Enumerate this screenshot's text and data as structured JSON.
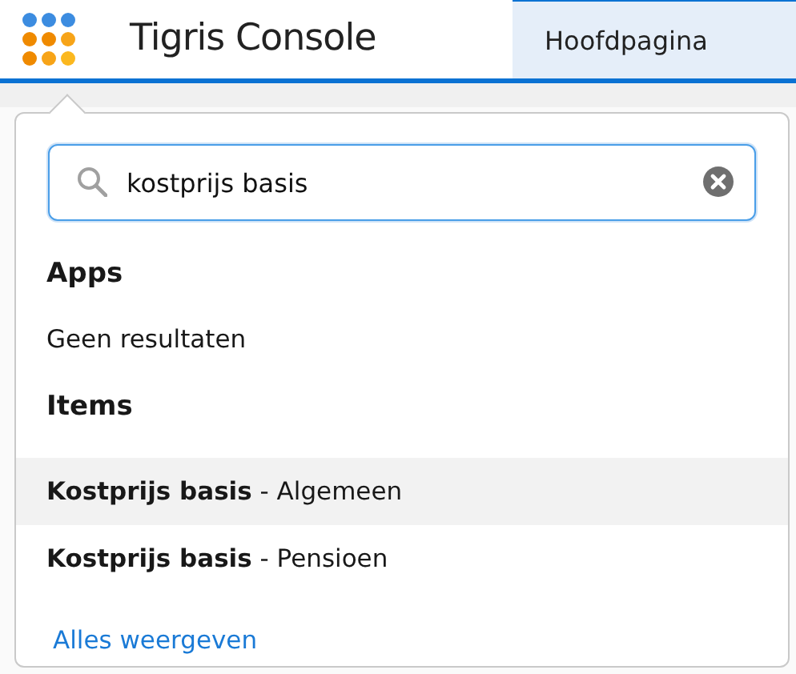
{
  "header": {
    "app_title": "Tigris Console",
    "tabs": [
      {
        "label": "Hoofdpagina",
        "selected": true
      }
    ]
  },
  "search_popup": {
    "search": {
      "value": "kostprijs basis"
    },
    "sections": [
      {
        "heading": "Apps",
        "empty_text": "Geen resultaten"
      },
      {
        "heading": "Items",
        "items": [
          {
            "label": "**Kostprijs basis** - Algemeen",
            "selected": true
          },
          {
            "label": "**Kostprijs basis** - Pensioen",
            "selected": false
          }
        ]
      }
    ],
    "show_all_link": "Alles weergeven"
  }
}
